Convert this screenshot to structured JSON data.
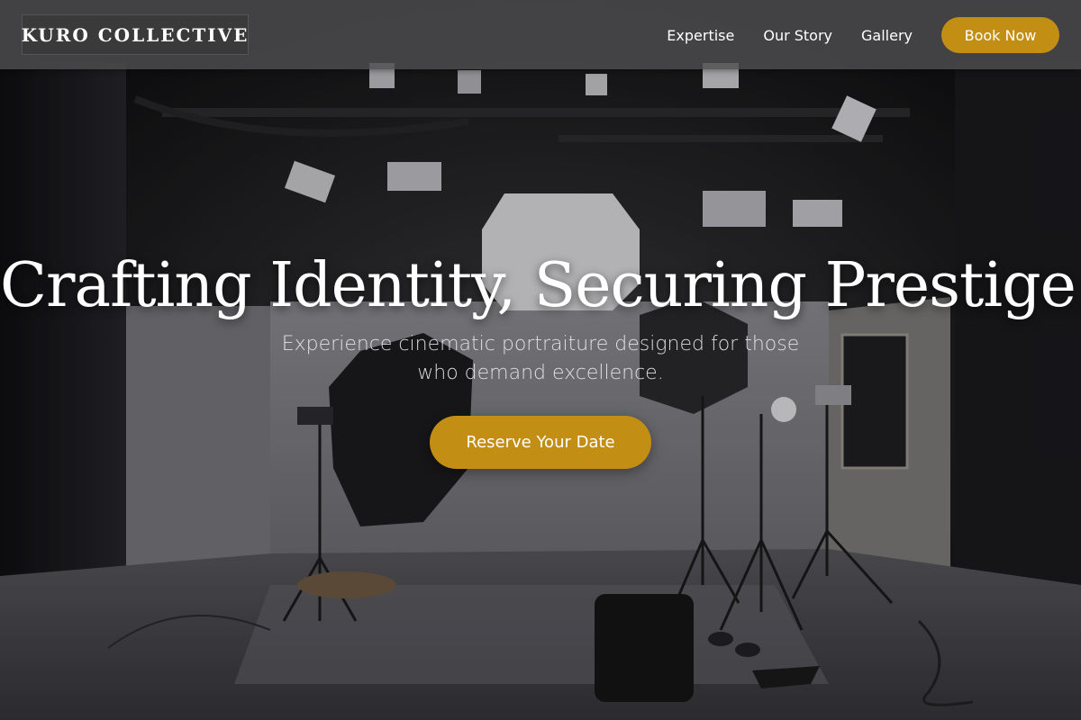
{
  "brand": {
    "name": "KURO COLLECTIVE"
  },
  "nav": {
    "items": [
      {
        "label": "Expertise"
      },
      {
        "label": "Our Story"
      },
      {
        "label": "Gallery"
      }
    ],
    "cta_label": "Book Now"
  },
  "hero": {
    "title": "Crafting Identity, Securing Prestige.",
    "subtitle_line1": "Experience cinematic portraiture designed for those",
    "subtitle_line2": "who demand excellence.",
    "cta_label": "Reserve Your Date",
    "background_image": "photography-studio-lighting-rig"
  },
  "colors": {
    "accent": "#c38e14",
    "header_bg": "#4e4e50",
    "logo_bg": "#3a3a3b",
    "text": "#ffffff"
  }
}
